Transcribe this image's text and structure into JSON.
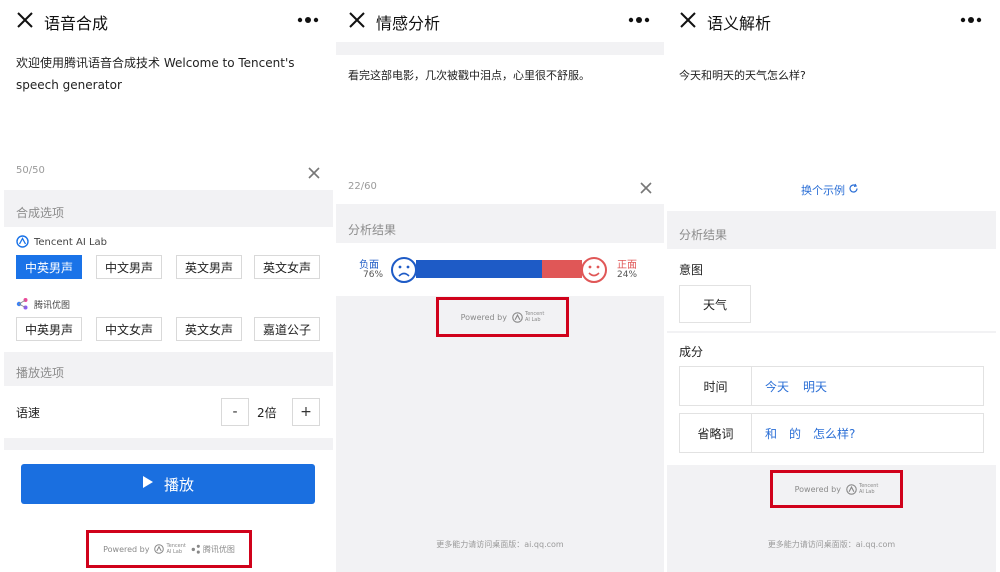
{
  "colors": {
    "accent": "#1a73e8",
    "negative": "#1e5bc6",
    "positive": "#e05757",
    "highlight_box": "#d0021b"
  },
  "panel1": {
    "title": "语音合成",
    "input_text": "欢迎使用腾讯语音合成技术 Welcome to Tencent's speech generator",
    "char_count": "50/50",
    "synthesis_options_label": "合成选项",
    "provider1": {
      "name": "Tencent AI Lab",
      "icon": "ai-lab-logo-icon"
    },
    "voices1": [
      "中英男声",
      "中文男声",
      "英文男声",
      "英文女声"
    ],
    "voices1_active_index": 0,
    "provider2": {
      "name": "腾讯优图",
      "icon": "youtu-logo-icon"
    },
    "voices2": [
      "中英男声",
      "中文女声",
      "英文女声",
      "嘉道公子"
    ],
    "playback_options_label": "播放选项",
    "speed_label": "语速",
    "speed_minus": "-",
    "speed_value": "2倍",
    "speed_plus": "+",
    "play_label": "播放",
    "powered_by": "Powered by",
    "lab_logo_line1": "Tencent",
    "lab_logo_line2": "AI Lab",
    "youtu_label": "腾讯优图"
  },
  "panel2": {
    "title": "情感分析",
    "input_text": "看完这部电影，几次被戳中泪点，心里很不舒服。",
    "char_count": "22/60",
    "result_label": "分析结果",
    "negative_label": "负面",
    "negative_percent": "76%",
    "negative_value": 76,
    "positive_label": "正面",
    "positive_percent": "24%",
    "positive_value": 24,
    "powered_by": "Powered by",
    "lab_logo_line1": "Tencent",
    "lab_logo_line2": "AI Lab",
    "footer": "更多能力请访问桌面版：ai.qq.com"
  },
  "panel3": {
    "title": "语义解析",
    "input_text": "今天和明天的天气怎么样?",
    "switch_example": "换个示例",
    "result_label": "分析结果",
    "intent_label": "意图",
    "intent_value": "天气",
    "components_label": "成分",
    "rows": [
      {
        "key": "时间",
        "values": [
          "今天",
          "明天"
        ]
      },
      {
        "key": "省略词",
        "values": [
          "和",
          "的",
          "怎么样?"
        ]
      }
    ],
    "powered_by": "Powered by",
    "lab_logo_line1": "Tencent",
    "lab_logo_line2": "AI Lab",
    "footer": "更多能力请访问桌面版：ai.qq.com"
  }
}
